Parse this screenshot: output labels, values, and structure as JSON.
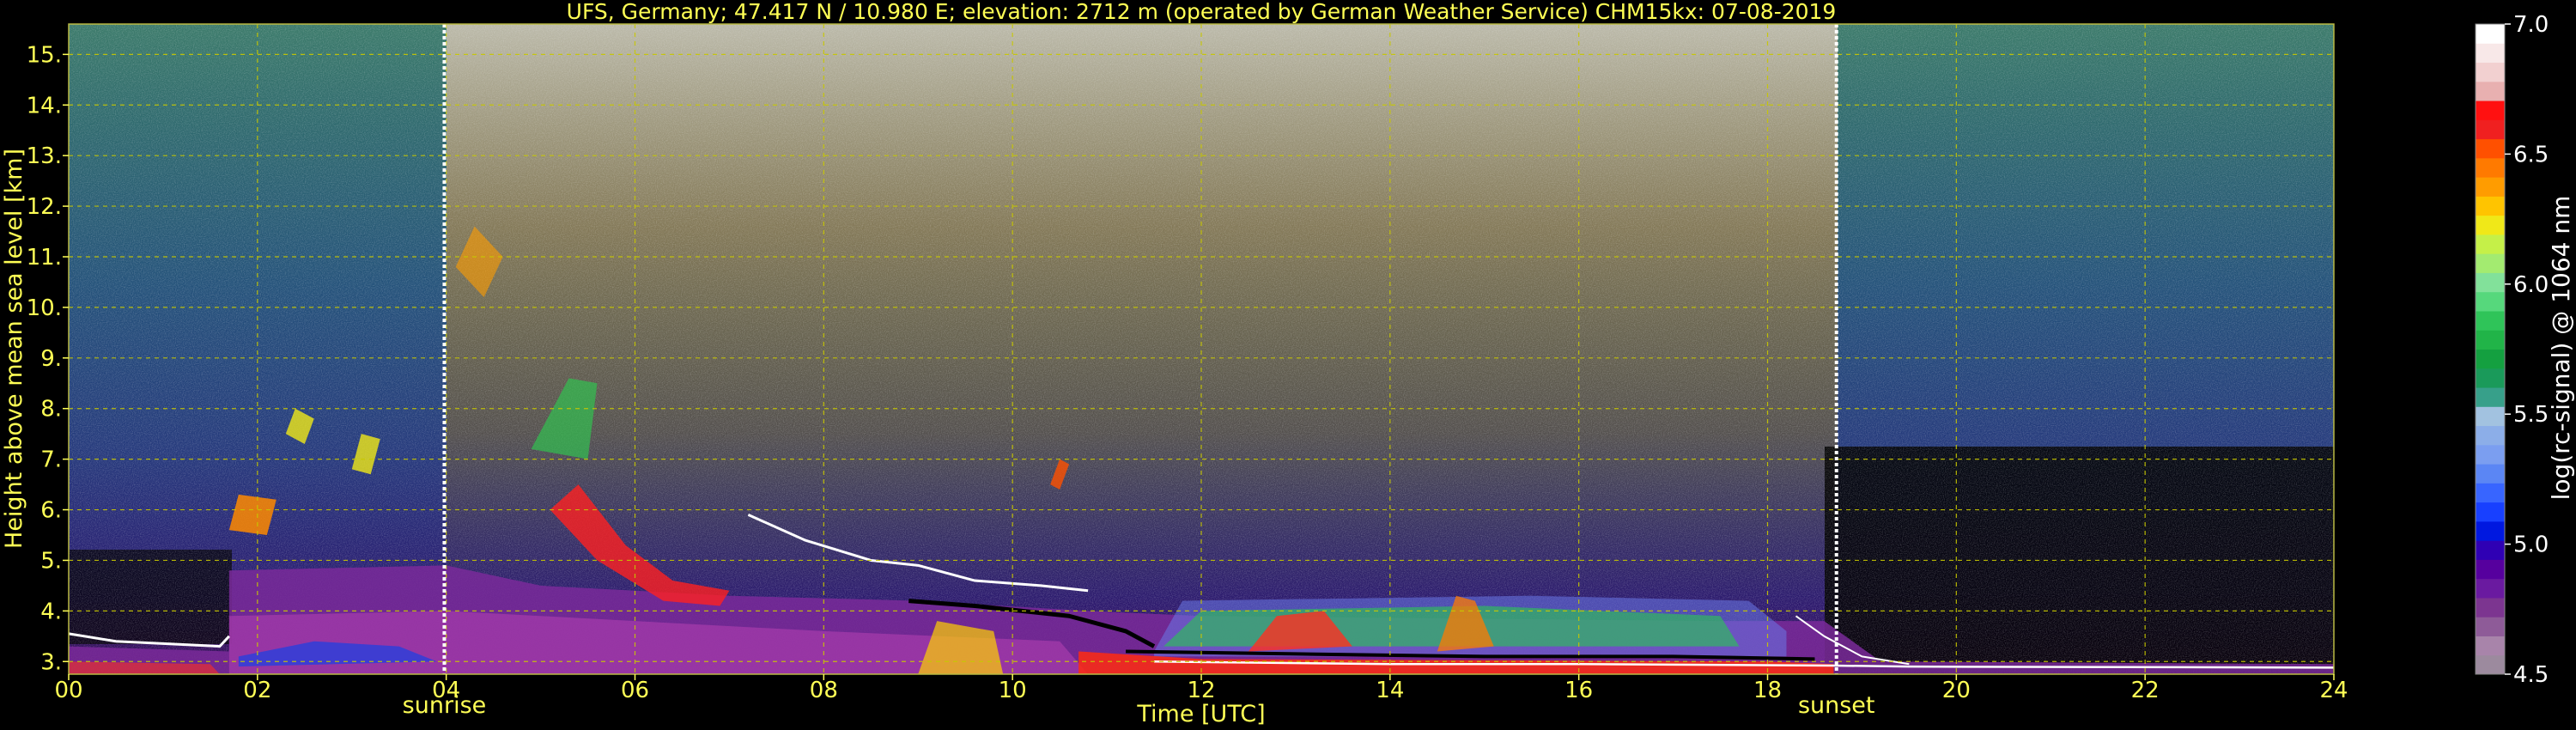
{
  "chart_data": {
    "type": "heatmap",
    "title": "UFS, Germany; 47.417 N / 10.980 E; elevation: 2712 m  (operated by German Weather Service)    CHM15kx: 07-08-2019",
    "xlabel": "Time [UTC]",
    "ylabel": "Height above mean sea level [km]",
    "xlim": [
      0,
      24
    ],
    "ylim": [
      2.75,
      15.6
    ],
    "x_ticks": [
      "00",
      "02",
      "04",
      "06",
      "08",
      "10",
      "12",
      "14",
      "16",
      "18",
      "20",
      "22",
      "24"
    ],
    "x_tick_values": [
      0,
      2,
      4,
      6,
      8,
      10,
      12,
      14,
      16,
      18,
      20,
      22,
      24
    ],
    "y_ticks": [
      "3.",
      "4.",
      "5.",
      "6.",
      "7.",
      "8.",
      "9.",
      "10.",
      "11.",
      "12.",
      "13.",
      "14.",
      "15."
    ],
    "y_tick_values": [
      3,
      4,
      5,
      6,
      7,
      8,
      9,
      10,
      11,
      12,
      13,
      14,
      15
    ],
    "grid": true,
    "annotations": [
      {
        "text": "sunrise",
        "x": 3.98
      },
      {
        "text": "sunset",
        "x": 18.73
      }
    ],
    "colorbar": {
      "label": "log(rc-signal) @ 1064 nm",
      "range": [
        4.5,
        7.0
      ],
      "ticks": [
        "4.5",
        "5.0",
        "5.5",
        "6.0",
        "6.5",
        "7.0"
      ],
      "tick_values": [
        4.5,
        5.0,
        5.5,
        6.0,
        6.5,
        7.0
      ],
      "colors": [
        "#9c8a9e",
        "#a884aa",
        "#8e5b98",
        "#7c3590",
        "#6a1aa0",
        "#56009e",
        "#2f00b4",
        "#0018e0",
        "#1840ff",
        "#3865ff",
        "#5b86f4",
        "#7b9ef0",
        "#8caee8",
        "#a2c2e0",
        "#37a08a",
        "#1a9a5a",
        "#14a040",
        "#21b448",
        "#2fc459",
        "#56d87c",
        "#82e19a",
        "#a3eb70",
        "#c5f048",
        "#f0e818",
        "#ffc400",
        "#ff9c00",
        "#ff7a00",
        "#ff5000",
        "#f02020",
        "#ff1010",
        "#e8b0b0",
        "#f2d0d0",
        "#f8e8e8",
        "#ffffff"
      ]
    }
  }
}
